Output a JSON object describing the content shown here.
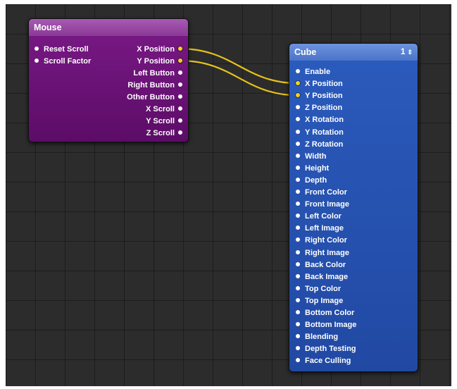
{
  "mouse_node": {
    "title": "Mouse",
    "inputs": [
      "Reset Scroll",
      "Scroll Factor"
    ],
    "outputs": [
      "X Position",
      "Y Position",
      "Left Button",
      "Right Button",
      "Other Button",
      "X Scroll",
      "Y Scroll",
      "Z Scroll"
    ]
  },
  "cube_node": {
    "title": "Cube",
    "instance_label": "1",
    "inputs": [
      "Enable",
      "X Position",
      "Y Position",
      "Z Position",
      "X Rotation",
      "Y Rotation",
      "Z Rotation",
      "Width",
      "Height",
      "Depth",
      "Front Color",
      "Front Image",
      "Left Color",
      "Left Image",
      "Right Color",
      "Right Image",
      "Back Color",
      "Back Image",
      "Top Color",
      "Top Image",
      "Bottom Color",
      "Bottom Image",
      "Blending",
      "Depth Testing",
      "Face Culling"
    ]
  },
  "connections": [
    {
      "from": "Mouse.X Position",
      "to": "Cube.X Position"
    },
    {
      "from": "Mouse.Y Position",
      "to": "Cube.Y Position"
    }
  ],
  "colors": {
    "canvas_bg": "#2c2c2c",
    "mouse_body": "#6c1478",
    "cube_body": "#2552b0",
    "wire": "#e6c21a",
    "active_port": "#f2d21a"
  }
}
